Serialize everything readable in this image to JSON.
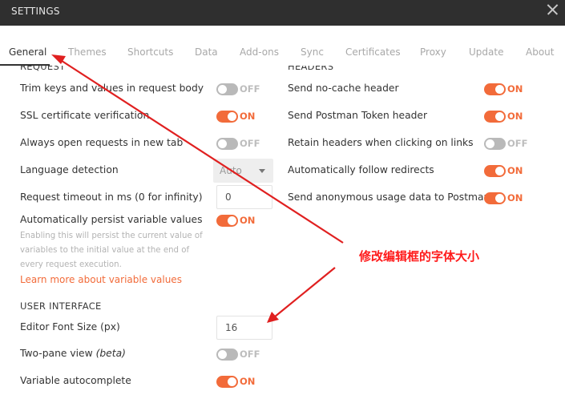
{
  "window": {
    "title": "SETTINGS"
  },
  "tabs": [
    "General",
    "Themes",
    "Shortcuts",
    "Data",
    "Add-ons",
    "Sync",
    "Certificates",
    "Proxy",
    "Update",
    "About"
  ],
  "request": {
    "section_title": "REQUEST",
    "trim_keys": {
      "label": "Trim keys and values in request body",
      "state": "OFF"
    },
    "ssl_verification": {
      "label": "SSL certificate verification",
      "state": "ON"
    },
    "open_new_tab": {
      "label": "Always open requests in new tab",
      "state": "OFF"
    },
    "language_detection": {
      "label": "Language detection",
      "value": "Auto"
    },
    "timeout": {
      "label": "Request timeout in ms (0 for infinity)",
      "value": "0"
    },
    "persist_vars": {
      "label": "Automatically persist variable values",
      "state": "ON"
    },
    "persist_note": [
      "Enabling this will persist the current value of",
      "variables to the initial value at the end of",
      "every request execution."
    ],
    "learn_more": "Learn more about variable values"
  },
  "headers": {
    "section_title": "HEADERS",
    "no_cache": {
      "label": "Send no-cache header",
      "state": "ON"
    },
    "postman_token": {
      "label": "Send Postman Token header",
      "state": "ON"
    },
    "retain_headers": {
      "label": "Retain headers when clicking on links",
      "state": "OFF"
    },
    "follow_redirects": {
      "label": "Automatically follow redirects",
      "state": "ON"
    },
    "usage_data": {
      "label": "Send anonymous usage data to Postman",
      "state": "ON"
    }
  },
  "ui": {
    "section_title": "USER INTERFACE",
    "editor_font_size": {
      "label": "Editor Font Size (px)",
      "value": "16"
    },
    "two_pane": {
      "label": "Two-pane view",
      "label_beta": "(beta)",
      "state": "OFF"
    },
    "var_autocomplete": {
      "label": "Variable autocomplete",
      "state": "ON"
    }
  },
  "annotation": {
    "text": "修改编辑框的字体大小",
    "color": "#ff1a1a"
  },
  "colors": {
    "accent": "#f26b3a",
    "titlebar": "#2f2f2f",
    "toggle_off": "#b9b9b9"
  }
}
